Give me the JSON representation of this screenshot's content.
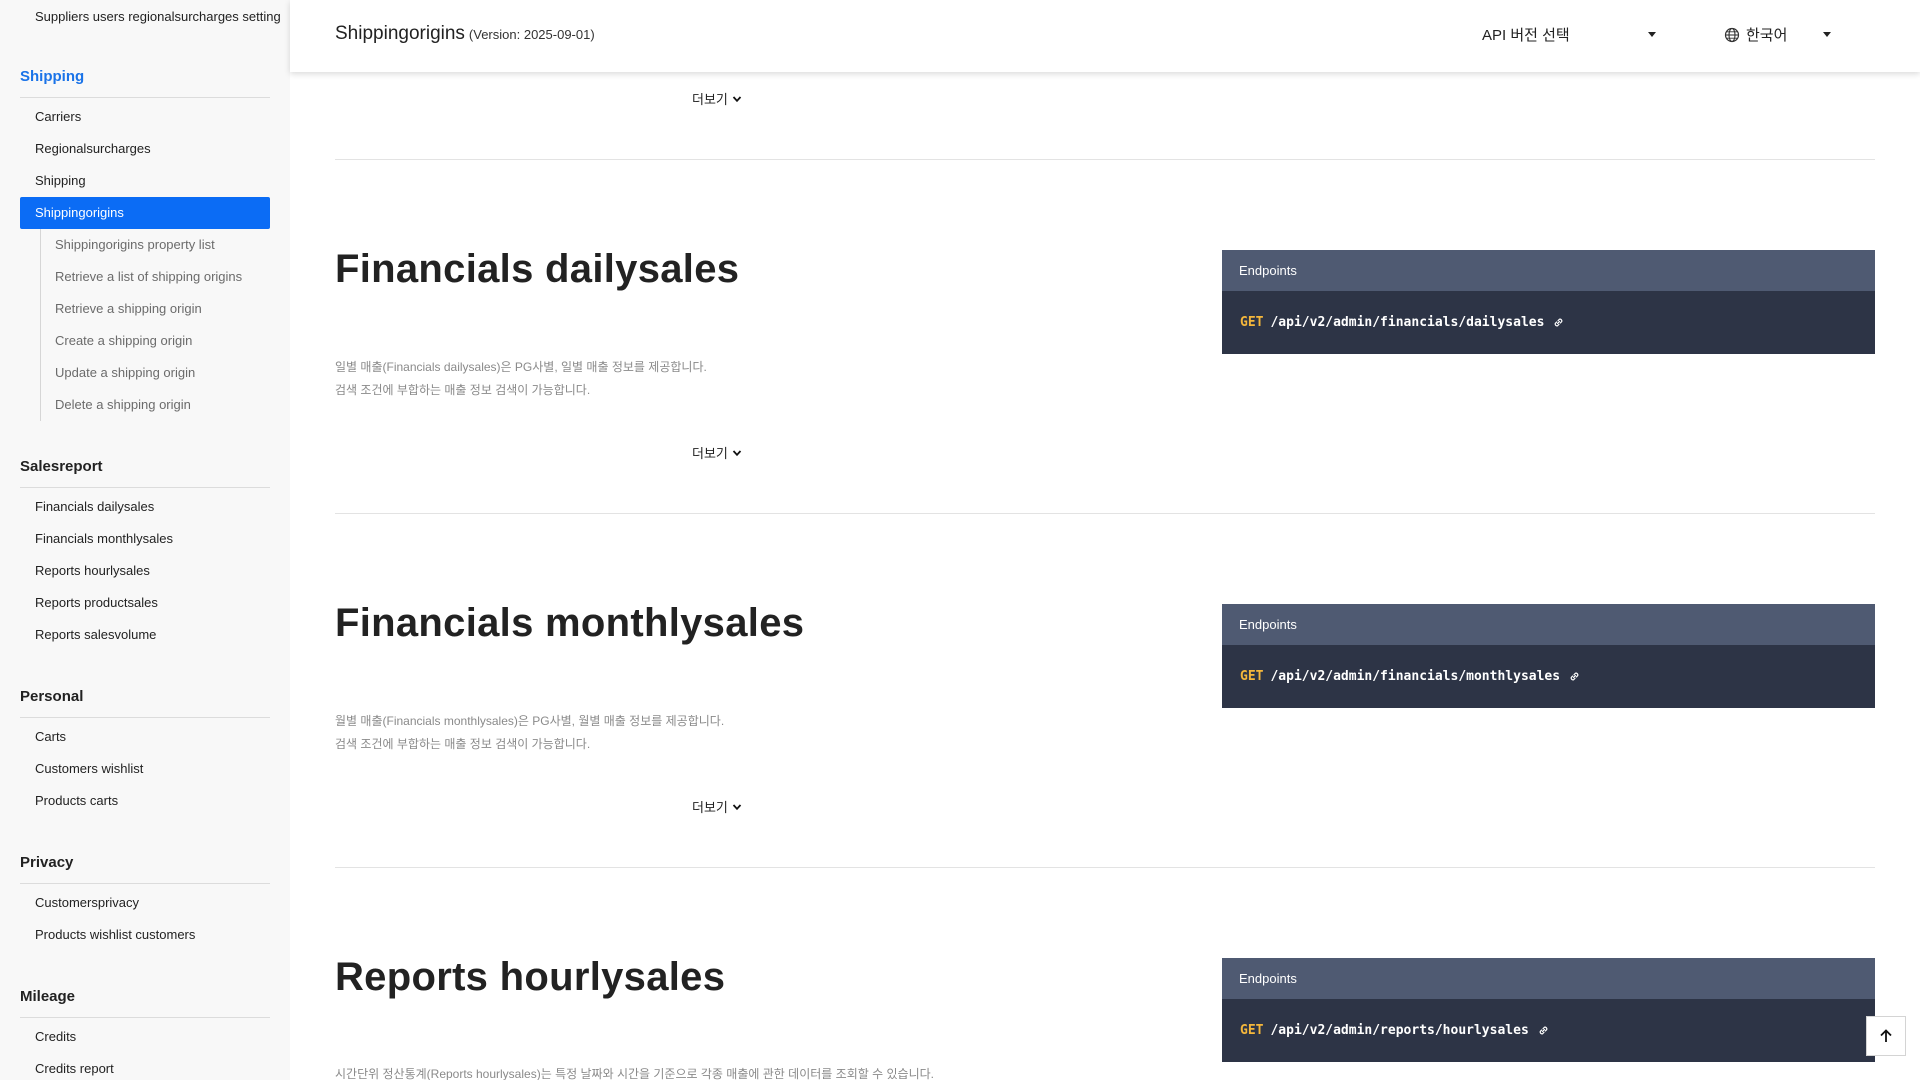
{
  "sidebar": {
    "top_item": "Suppliers users regionalsurcharges setting",
    "sections": {
      "shipping": {
        "title": "Shipping",
        "items": [
          "Carriers",
          "Regionalsurcharges",
          "Shipping",
          "Shippingorigins"
        ],
        "selected": "Shippingorigins",
        "subitems": [
          "Shippingorigins property list",
          "Retrieve a list of shipping origins",
          "Retrieve a shipping origin",
          "Create a shipping origin",
          "Update a shipping origin",
          "Delete a shipping origin"
        ]
      },
      "salesreport": {
        "title": "Salesreport",
        "items": [
          "Financials dailysales",
          "Financials monthlysales",
          "Reports hourlysales",
          "Reports productsales",
          "Reports salesvolume"
        ]
      },
      "personal": {
        "title": "Personal",
        "items": [
          "Carts",
          "Customers wishlist",
          "Products carts"
        ]
      },
      "privacy": {
        "title": "Privacy",
        "items": [
          "Customersprivacy",
          "Products wishlist customers"
        ]
      },
      "mileage": {
        "title": "Mileage",
        "items": [
          "Credits",
          "Credits report"
        ]
      }
    }
  },
  "header": {
    "title": "Shippingorigins",
    "version": "(Version: 2025-09-01)",
    "api_select_label": "API 버전 선택",
    "language_label": "한국어",
    "globe_icon": "globe-icon"
  },
  "main": {
    "more_label": "더보기",
    "endpoints_label": "Endpoints",
    "sections": [
      {
        "title": "Financials dailysales",
        "desc_line1": "일별 매출(Financials dailysales)은 PG사별, 일별 매출 정보를 제공합니다.",
        "desc_line2": "검색 조건에 부합하는 매출 정보 검색이 가능합니다.",
        "method": "GET",
        "path": "/api/v2/admin/financials/dailysales"
      },
      {
        "title": "Financials monthlysales",
        "desc_line1": "월별 매출(Financials monthlysales)은 PG사별, 월별 매출 정보를 제공합니다.",
        "desc_line2": "검색 조건에 부합하는 매출 정보 검색이 가능합니다.",
        "method": "GET",
        "path": "/api/v2/admin/financials/monthlysales"
      },
      {
        "title": "Reports hourlysales",
        "desc_line1": "시간단위 정산통계(Reports hourlysales)는 특정 날짜와 시간을 기준으로 각종 매출에 관한 데이터를 조회할 수 있습니다.",
        "method": "GET",
        "path": "/api/v2/admin/reports/hourlysales"
      }
    ]
  },
  "colors": {
    "accent": "#0b6cf5",
    "endpoint_head": "#4f5a72",
    "endpoint_body": "#2d3446",
    "method": "#f5b73b"
  }
}
